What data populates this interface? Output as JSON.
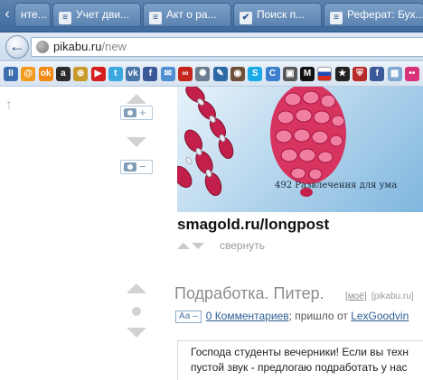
{
  "browser": {
    "tabs": [
      {
        "label": "нте..."
      },
      {
        "label": "Учет дви..."
      },
      {
        "label": "Акт о pa..."
      },
      {
        "label": "Поиск п..."
      },
      {
        "label": "Реферат: Бух..."
      }
    ],
    "url_host": "pikabu.ru",
    "url_path": "/new"
  },
  "bookmarks": [
    {
      "icon": "pause-icon",
      "glyph": "II",
      "color": "#3d6fb0"
    },
    {
      "icon": "mail-at-icon",
      "glyph": "@",
      "color": "#f39a1e"
    },
    {
      "icon": "odnoklassniki-icon",
      "glyph": "ok",
      "color": "#f08a13"
    },
    {
      "icon": "amazon-icon",
      "glyph": "a",
      "color": "#2b2b2b"
    },
    {
      "icon": "shopping-cart-icon",
      "glyph": "⊕",
      "color": "#c89a2a"
    },
    {
      "icon": "youtube-icon",
      "glyph": "▶",
      "color": "#d51e1e"
    },
    {
      "icon": "twitter-icon",
      "glyph": "t",
      "color": "#39a9e0"
    },
    {
      "icon": "vk-icon",
      "glyph": "vk",
      "color": "#4a76a8"
    },
    {
      "icon": "facebook-icon",
      "glyph": "f",
      "color": "#3b5998"
    },
    {
      "icon": "mail-envelope-icon",
      "glyph": "✉",
      "color": "#4f8fd1"
    },
    {
      "icon": "lastfm-icon",
      "glyph": "∞",
      "color": "#c5271f"
    },
    {
      "icon": "gear-icon",
      "glyph": "✺",
      "color": "#6d7e90"
    },
    {
      "icon": "livejournal-icon",
      "glyph": "✎",
      "color": "#2c6aa6"
    },
    {
      "icon": "instagram-icon",
      "glyph": "◉",
      "color": "#6f4f3a"
    },
    {
      "icon": "skype-icon",
      "glyph": "S",
      "color": "#19a9e6"
    },
    {
      "icon": "chrome-c-icon",
      "glyph": "C",
      "color": "#3d7fcc"
    },
    {
      "icon": "photo-icon",
      "glyph": "▣",
      "color": "#585858"
    },
    {
      "icon": "m-logo-icon",
      "glyph": "M",
      "color": "#111111"
    },
    {
      "icon": "russia-flag-icon",
      "glyph": "",
      "color": "#ffffff"
    },
    {
      "icon": "star-icon",
      "glyph": "★",
      "color": "#222222"
    },
    {
      "icon": "shield-icon",
      "glyph": "⛨",
      "color": "#b72a2a"
    },
    {
      "icon": "facebook-square-icon",
      "glyph": "f",
      "color": "#3b5998"
    },
    {
      "icon": "grid-icon",
      "glyph": "▦",
      "color": "#7ea7d1"
    },
    {
      "icon": "dots-icon",
      "glyph": "••",
      "color": "#d8337a"
    }
  ],
  "post1": {
    "image_caption": "492 Развлечения для ума",
    "link": "smagold.ru/longpost",
    "collapse": "свернуть"
  },
  "post2": {
    "title": "Подработка. Питер.",
    "moe_tag": "[моё]",
    "source_tag": "[pikabu.ru]",
    "font_toggle": "Аа –",
    "comments": "0 Комментариев",
    "meta_text": "; пришло от",
    "author": "LexGoodvin",
    "body_line1": "Господа студенты вечерники! Если вы техн",
    "body_line2": "пустой звук - предлогаю подработать у нас"
  },
  "colors": {
    "accent_link": "#2f5f95",
    "bead_red": "#c21f4a",
    "sky_blue": "#9fc8e8"
  }
}
